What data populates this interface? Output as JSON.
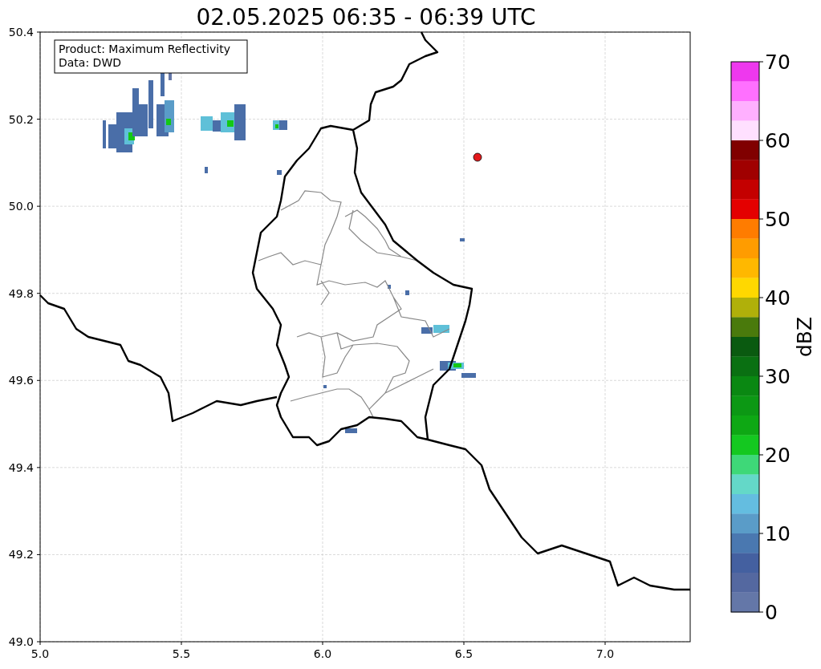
{
  "title": "02.05.2025 06:35 - 06:39 UTC",
  "legend": [
    "Product: Maximum Reflectivity",
    "Data: DWD"
  ],
  "x_ticks": [
    "5.0",
    "5.5",
    "6.0",
    "6.5",
    "7.0"
  ],
  "y_ticks": [
    "50.4",
    "50.2",
    "50.0",
    "49.8",
    "49.6",
    "49.4",
    "49.2",
    "49.0"
  ],
  "colorbar": {
    "label": "dBZ",
    "ticks": [
      "70",
      "60",
      "50",
      "40",
      "30",
      "20",
      "10",
      "0"
    ],
    "segments": [
      {
        "color": "#ee38ee"
      },
      {
        "color": "#ff70ff"
      },
      {
        "color": "#ffb0ff"
      },
      {
        "color": "#ffe0ff"
      },
      {
        "color": "#800000"
      },
      {
        "color": "#a00000"
      },
      {
        "color": "#c40000"
      },
      {
        "color": "#e40000"
      },
      {
        "color": "#ff7c00"
      },
      {
        "color": "#ff9c00"
      },
      {
        "color": "#ffb800"
      },
      {
        "color": "#ffd800"
      },
      {
        "color": "#b0b00a"
      },
      {
        "color": "#4a7a0c"
      },
      {
        "color": "#0a5a10"
      },
      {
        "color": "#0a7012"
      },
      {
        "color": "#0a8812"
      },
      {
        "color": "#0c9814"
      },
      {
        "color": "#0ea814"
      },
      {
        "color": "#14c820"
      },
      {
        "color": "#3ed878"
      },
      {
        "color": "#64d8c8"
      },
      {
        "color": "#64bde0"
      },
      {
        "color": "#5a9cc8"
      },
      {
        "color": "#4a78b0"
      },
      {
        "color": "#4460a0"
      },
      {
        "color": "#5468a0"
      },
      {
        "color": "#6477a8"
      }
    ]
  }
}
